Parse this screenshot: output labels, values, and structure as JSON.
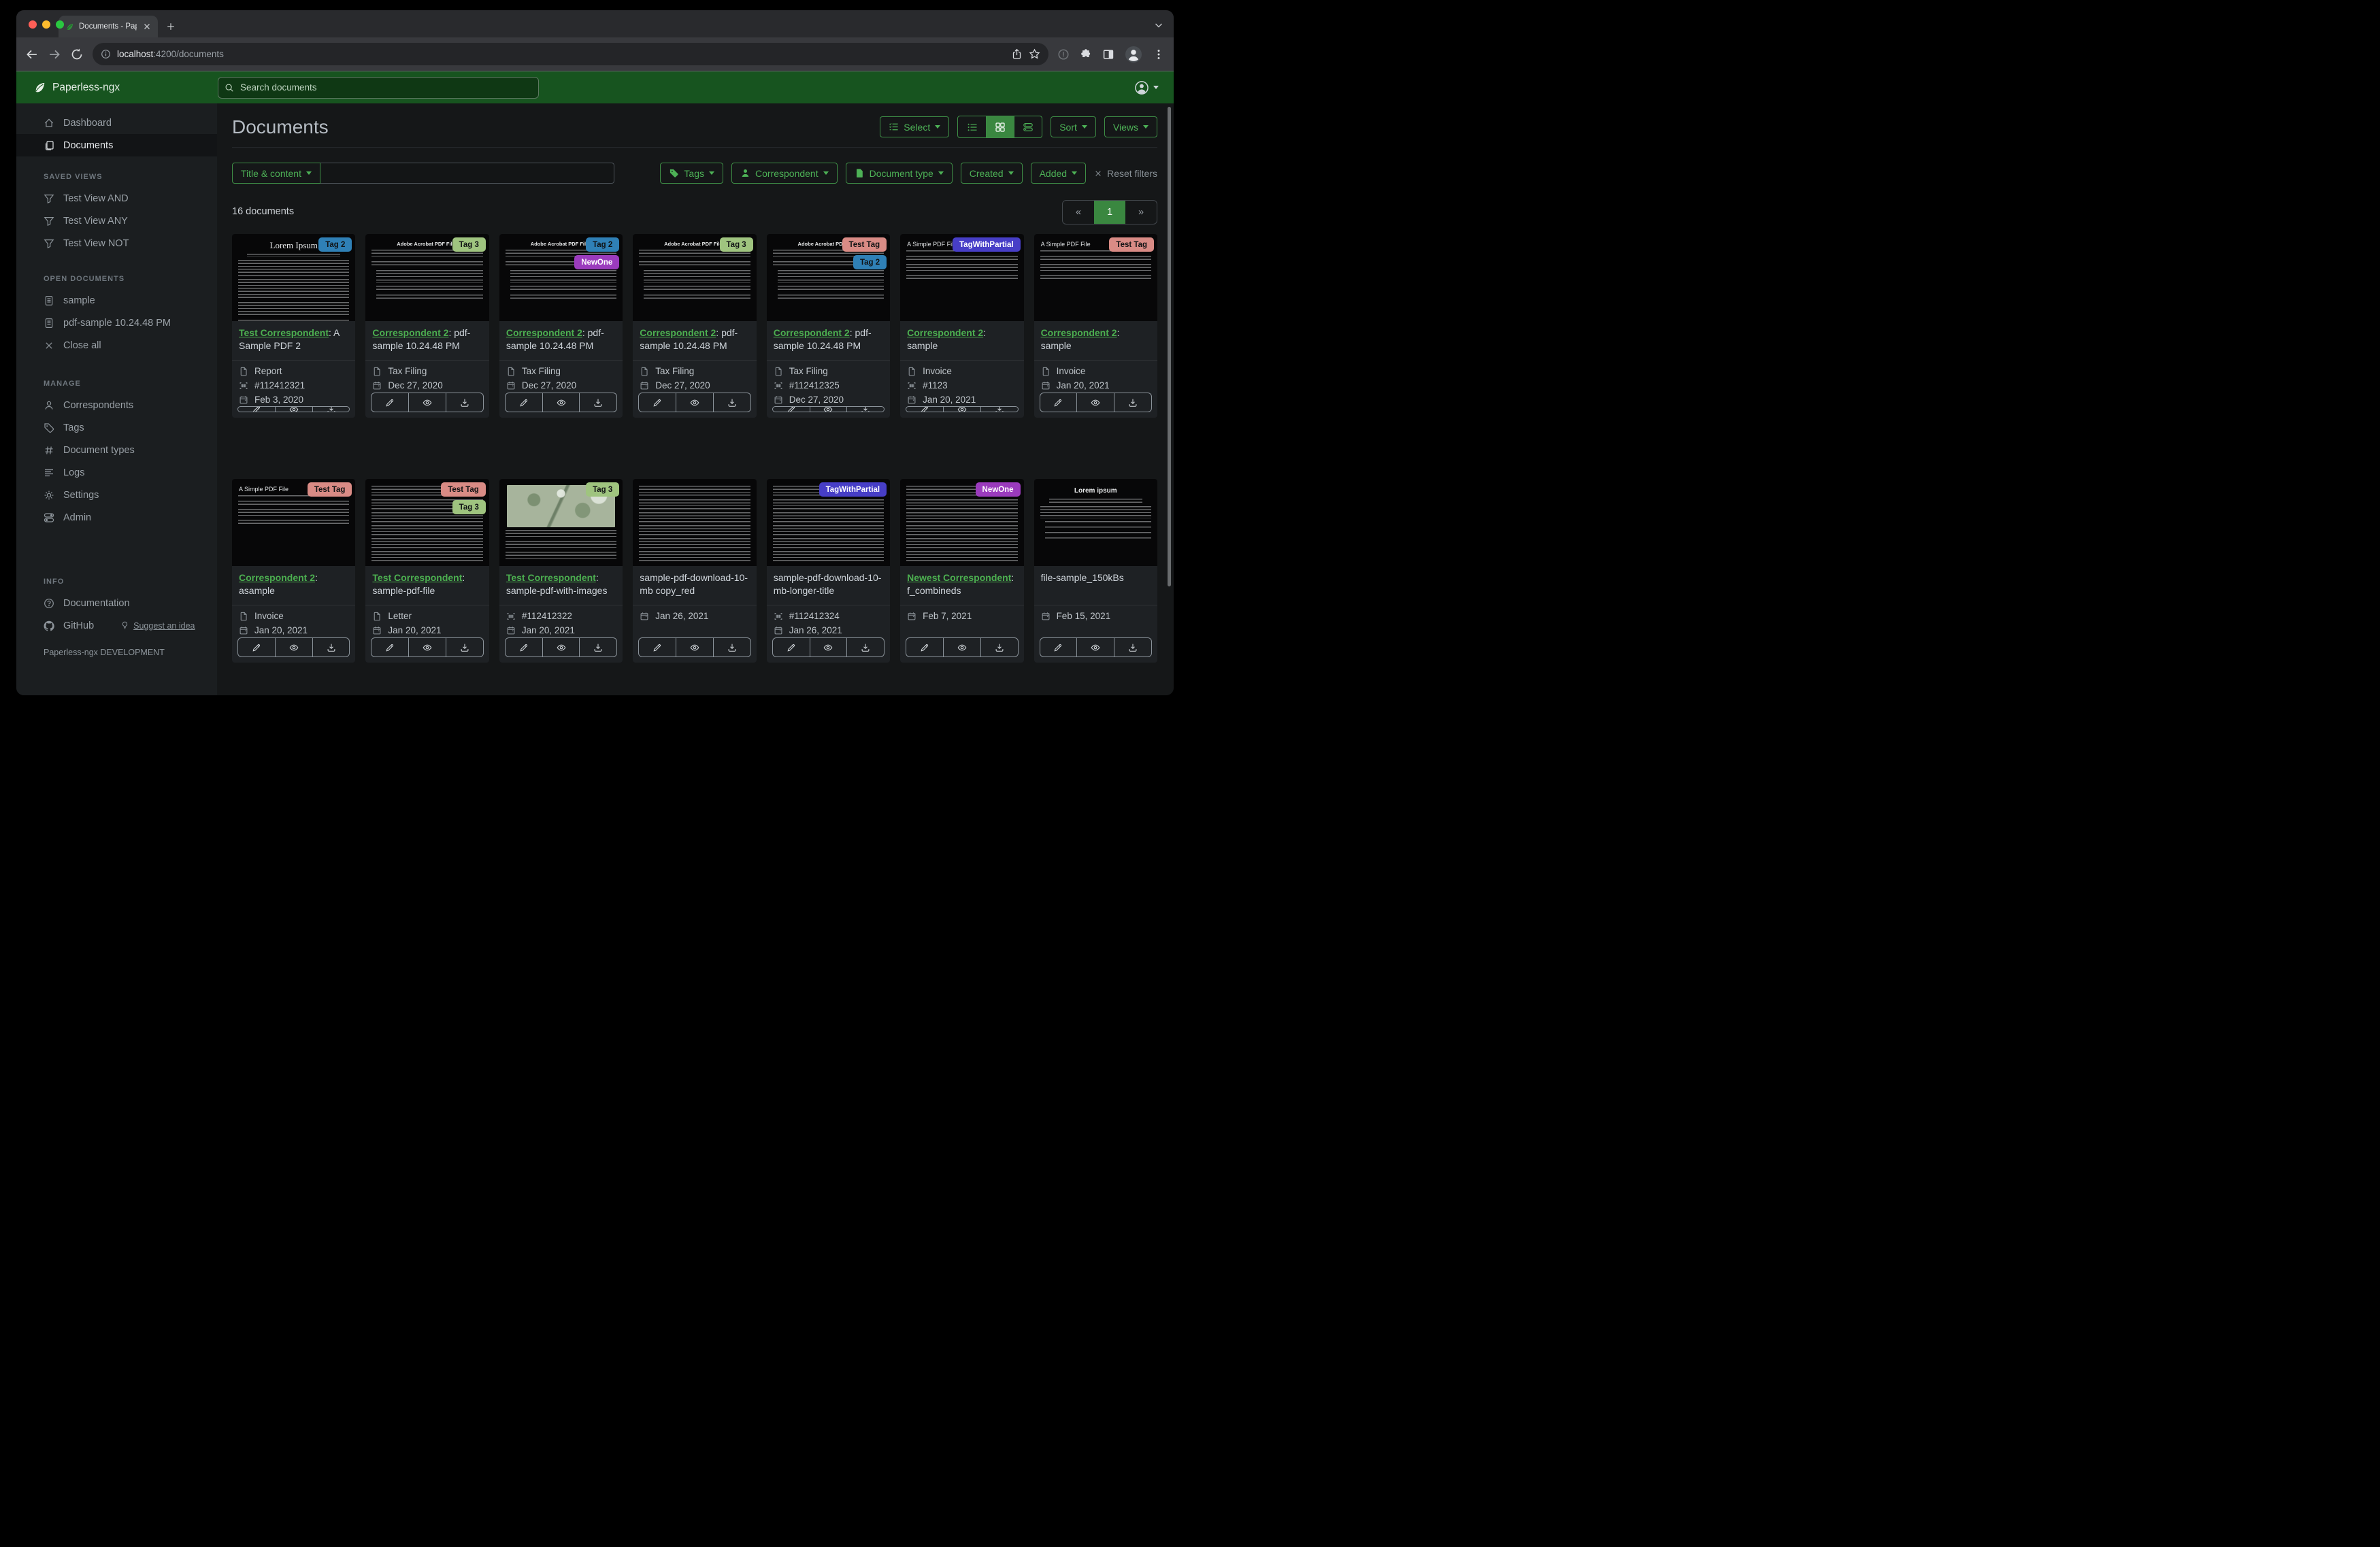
{
  "browser": {
    "tab_title": "Documents - Paperless-ngx",
    "url_host": "localhost",
    "url_rest": ":4200/documents",
    "traffic_lights": [
      "#ff5f57",
      "#febc2e",
      "#2ac840"
    ]
  },
  "navbar": {
    "brand": "Paperless-ngx",
    "search_placeholder": "Search documents"
  },
  "sidebar": {
    "items_top": [
      {
        "label": "Dashboard",
        "icon": "house",
        "active": false
      },
      {
        "label": "Documents",
        "icon": "copy",
        "active": true
      }
    ],
    "sections": [
      {
        "key": "savedviews",
        "header": "SAVED VIEWS",
        "items": [
          {
            "label": "Test View AND",
            "icon": "funnel"
          },
          {
            "label": "Test View ANY",
            "icon": "funnel"
          },
          {
            "label": "Test View NOT",
            "icon": "funnel"
          }
        ]
      },
      {
        "key": "opendocs",
        "header": "OPEN DOCUMENTS",
        "items": [
          {
            "label": "sample",
            "icon": "file-text"
          },
          {
            "label": "pdf-sample 10.24.48 PM",
            "icon": "file-text"
          },
          {
            "label": "Close all",
            "icon": "x"
          }
        ]
      },
      {
        "key": "manage",
        "header": "MANAGE",
        "items": [
          {
            "label": "Correspondents",
            "icon": "person"
          },
          {
            "label": "Tags",
            "icon": "tag"
          },
          {
            "label": "Document types",
            "icon": "hash"
          },
          {
            "label": "Logs",
            "icon": "text-left"
          },
          {
            "label": "Settings",
            "icon": "gear"
          },
          {
            "label": "Admin",
            "icon": "toggles"
          }
        ]
      },
      {
        "key": "info",
        "header": "INFO",
        "items": [
          {
            "label": "Documentation",
            "icon": "question-circle"
          },
          {
            "label": "GitHub",
            "icon": "github",
            "extra": {
              "label": "Suggest an idea",
              "icon": "lightbulb"
            }
          }
        ]
      }
    ],
    "footer": "Paperless-ngx DEVELOPMENT"
  },
  "header": {
    "title": "Documents",
    "select_label": "Select",
    "sort_label": "Sort",
    "views_label": "Views",
    "view_modes": [
      {
        "icon": "list-ul",
        "name": "list-view",
        "active": false
      },
      {
        "icon": "grid",
        "name": "grid-view",
        "active": true
      },
      {
        "icon": "hlist",
        "name": "detail-view",
        "active": false
      }
    ]
  },
  "filters": {
    "field_label": "Title & content",
    "query_value": "",
    "buttons": [
      {
        "label": "Tags",
        "icon": "tag-fill"
      },
      {
        "label": "Correspondent",
        "icon": "person-fill"
      },
      {
        "label": "Document type",
        "icon": "file-fill"
      },
      {
        "label": "Created",
        "icon": ""
      },
      {
        "label": "Added",
        "icon": ""
      }
    ],
    "reset_label": "Reset filters"
  },
  "results": {
    "count_text": "16 documents",
    "pagination": {
      "prev": "«",
      "page": "1",
      "next": "»"
    }
  },
  "tag_palette": {
    "Tag 2": {
      "bg": "#2f80b6",
      "fg": "#101214"
    },
    "Tag 3": {
      "bg": "#9fc47f",
      "fg": "#101214"
    },
    "Test Tag": {
      "bg": "#d98b85",
      "fg": "#101214"
    },
    "NewOne": {
      "bg": "#9b3bbd",
      "fg": "#ffffff"
    },
    "TagWithPartial": {
      "bg": "#473ec7",
      "fg": "#ffffff"
    }
  },
  "card_actions": [
    {
      "name": "edit",
      "icon": "pencil"
    },
    {
      "name": "preview",
      "icon": "eye"
    },
    {
      "name": "download",
      "icon": "download"
    }
  ],
  "cards": [
    {
      "link": "Test Correspondent",
      "rest": ": A Sample PDF 2",
      "tags": [
        "Tag 2"
      ],
      "thumb": {
        "variant": "lorem",
        "heading": "Lorem Ipsum"
      },
      "meta": [
        {
          "icon": "file",
          "text": "Report"
        },
        {
          "icon": "upc",
          "text": "#112412321"
        },
        {
          "icon": "calendar",
          "text": "Feb 3, 2020"
        }
      ]
    },
    {
      "link": "Correspondent 2",
      "rest": ": pdf-sample 10.24.48 PM",
      "tags": [
        "Tag 3"
      ],
      "thumb": {
        "variant": "adobe",
        "heading": "Adobe Acrobat PDF Files"
      },
      "meta": [
        {
          "icon": "file",
          "text": "Tax Filing"
        },
        {
          "icon": "calendar",
          "text": "Dec 27, 2020"
        }
      ]
    },
    {
      "link": "Correspondent 2",
      "rest": ": pdf-sample 10.24.48 PM",
      "tags": [
        "Tag 2",
        "NewOne"
      ],
      "thumb": {
        "variant": "adobe",
        "heading": "Adobe Acrobat PDF Files"
      },
      "meta": [
        {
          "icon": "file",
          "text": "Tax Filing"
        },
        {
          "icon": "calendar",
          "text": "Dec 27, 2020"
        }
      ]
    },
    {
      "link": "Correspondent 2",
      "rest": ": pdf-sample 10.24.48 PM",
      "tags": [
        "Tag 3"
      ],
      "thumb": {
        "variant": "adobe",
        "heading": "Adobe Acrobat PDF Files"
      },
      "meta": [
        {
          "icon": "file",
          "text": "Tax Filing"
        },
        {
          "icon": "calendar",
          "text": "Dec 27, 2020"
        }
      ]
    },
    {
      "link": "Correspondent 2",
      "rest": ": pdf-sample 10.24.48 PM",
      "tags": [
        "Test Tag",
        "Tag 2"
      ],
      "thumb": {
        "variant": "adobe",
        "heading": "Adobe Acrobat PDF Files"
      },
      "meta": [
        {
          "icon": "file",
          "text": "Tax Filing"
        },
        {
          "icon": "upc",
          "text": "#112412325"
        },
        {
          "icon": "calendar",
          "text": "Dec 27, 2020"
        }
      ]
    },
    {
      "link": "Correspondent 2",
      "rest": ": sample",
      "tags": [
        "TagWithPartial"
      ],
      "thumb": {
        "variant": "simple",
        "heading": "A Simple PDF File"
      },
      "meta": [
        {
          "icon": "file",
          "text": "Invoice"
        },
        {
          "icon": "upc",
          "text": "#1123"
        },
        {
          "icon": "calendar",
          "text": "Jan 20, 2021"
        }
      ]
    },
    {
      "link": "Correspondent 2",
      "rest": ": sample",
      "tags": [
        "Test Tag"
      ],
      "thumb": {
        "variant": "simple",
        "heading": "A Simple PDF File"
      },
      "meta": [
        {
          "icon": "file",
          "text": "Invoice"
        },
        {
          "icon": "calendar",
          "text": "Jan 20, 2021"
        }
      ]
    },
    {
      "link": "Correspondent 2",
      "rest": ": asample",
      "tags": [
        "Test Tag"
      ],
      "thumb": {
        "variant": "simple",
        "heading": "A Simple PDF File"
      },
      "meta": [
        {
          "icon": "file",
          "text": "Invoice"
        },
        {
          "icon": "calendar",
          "text": "Jan 20, 2021"
        }
      ]
    },
    {
      "link": "Test Correspondent",
      "rest": ": sample-pdf-file",
      "tags": [
        "Test Tag",
        "Tag 3"
      ],
      "thumb": {
        "variant": "dense",
        "heading": ""
      },
      "meta": [
        {
          "icon": "file",
          "text": "Letter"
        },
        {
          "icon": "calendar",
          "text": "Jan 20, 2021"
        }
      ]
    },
    {
      "link": "Test Correspondent",
      "rest": ": sample-pdf-with-images",
      "tags": [
        "Tag 3"
      ],
      "thumb": {
        "variant": "map",
        "heading": ""
      },
      "meta": [
        {
          "icon": "upc",
          "text": "#112412322"
        },
        {
          "icon": "calendar",
          "text": "Jan 20, 2021"
        }
      ]
    },
    {
      "link": "",
      "rest": "sample-pdf-download-10-mb copy_red",
      "tags": [],
      "thumb": {
        "variant": "dense",
        "heading": ""
      },
      "meta": [
        {
          "icon": "calendar",
          "text": "Jan 26, 2021"
        }
      ]
    },
    {
      "link": "",
      "rest": "sample-pdf-download-10-mb-longer-title",
      "tags": [
        "TagWithPartial"
      ],
      "thumb": {
        "variant": "dense",
        "heading": ""
      },
      "meta": [
        {
          "icon": "upc",
          "text": "#112412324"
        },
        {
          "icon": "calendar",
          "text": "Jan 26, 2021"
        }
      ]
    },
    {
      "link": "Newest Correspondent",
      "rest": ": f_combineds",
      "tags": [
        "NewOne"
      ],
      "thumb": {
        "variant": "dense",
        "heading": ""
      },
      "meta": [
        {
          "icon": "calendar",
          "text": "Feb 7, 2021"
        }
      ]
    },
    {
      "link": "",
      "rest": "file-sample_150kBs",
      "tags": [],
      "thumb": {
        "variant": "lorem2",
        "heading": "Lorem ipsum"
      },
      "meta": [
        {
          "icon": "calendar",
          "text": "Feb 15, 2021"
        }
      ]
    }
  ],
  "colors": {
    "navbar_green": "#17541f",
    "accent_green": "#4db156",
    "active_green": "#3a8740",
    "link_green": "#4caf50"
  }
}
